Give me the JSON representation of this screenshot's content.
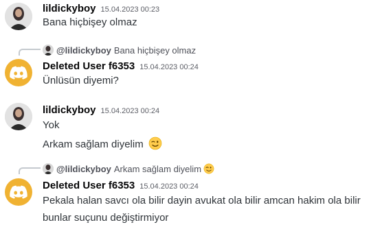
{
  "messages": [
    {
      "username": "lildickyboy",
      "timestamp": "15.04.2023 00:23",
      "lines": [
        "Bana hiçbişey olmaz"
      ]
    },
    {
      "reply": {
        "username": "@lildickyboy",
        "text": "Bana hiçbişey olmaz"
      },
      "username": "Deleted User f6353",
      "timestamp": "15.04.2023 00:24",
      "lines": [
        "Ünlüsün diyemi?"
      ]
    },
    {
      "username": "lildickyboy",
      "timestamp": "15.04.2023 00:24",
      "lines": [
        "Yok",
        "Arkam sağlam diyelim"
      ]
    },
    {
      "reply": {
        "username": "@lildickyboy",
        "text": "Arkam sağlam diyelim"
      },
      "username": "Deleted User f6353",
      "timestamp": "15.04.2023 00:24",
      "lines": [
        "Pekala halan savcı ola bilir dayin avukat ola bilir amcan hakim ola bilir",
        "bunlar suçunu değiştirmiyor"
      ]
    }
  ],
  "icons": {
    "user_avatar": "user-photo-avatar",
    "deleted_avatar": "discord-logo-avatar",
    "wink": "winking-face-emoji"
  },
  "colors": {
    "deleted_avatar_bg": "#f0b232",
    "username": "#060607",
    "timestamp": "#5c5e66"
  }
}
